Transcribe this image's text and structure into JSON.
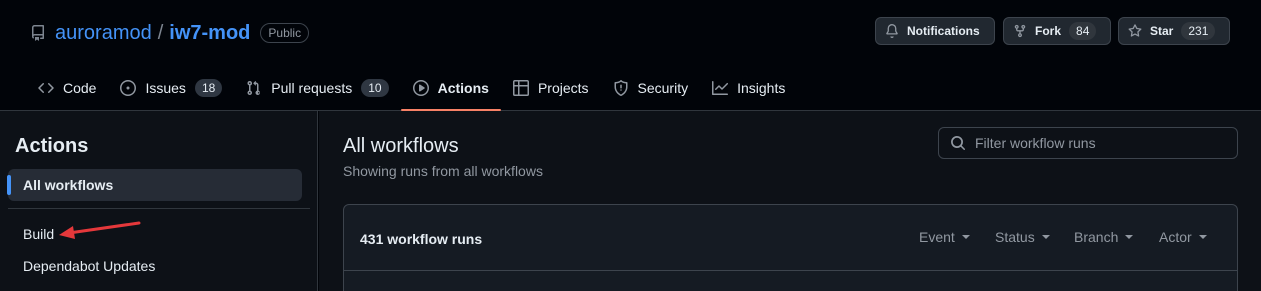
{
  "repo": {
    "owner": "auroramod",
    "separator": "/",
    "name": "iw7-mod",
    "visibility": "Public"
  },
  "header_buttons": {
    "notifications": {
      "label": "Notifications"
    },
    "fork": {
      "label": "Fork",
      "count": "84"
    },
    "star": {
      "label": "Star",
      "count": "231"
    }
  },
  "tabs": [
    {
      "label": "Code",
      "icon": "code-icon"
    },
    {
      "label": "Issues",
      "count": "18",
      "icon": "issue-icon"
    },
    {
      "label": "Pull requests",
      "count": "10",
      "icon": "pull-request-icon"
    },
    {
      "label": "Actions",
      "icon": "play-icon",
      "active": true
    },
    {
      "label": "Projects",
      "icon": "table-icon"
    },
    {
      "label": "Security",
      "icon": "shield-icon"
    },
    {
      "label": "Insights",
      "icon": "graph-icon"
    }
  ],
  "sidebar": {
    "title": "Actions",
    "items": [
      {
        "label": "All workflows",
        "active": true
      },
      {
        "label": "Build"
      },
      {
        "label": "Dependabot Updates"
      }
    ]
  },
  "main": {
    "title": "All workflows",
    "subtitle": "Showing runs from all workflows",
    "filter_placeholder": "Filter workflow runs",
    "runs_count": "431 workflow runs",
    "filters": [
      "Event",
      "Status",
      "Branch",
      "Actor"
    ]
  },
  "colors": {
    "accent": "#4493f8",
    "active_tab": "#f78166",
    "annotation_arrow": "#e5383b"
  }
}
